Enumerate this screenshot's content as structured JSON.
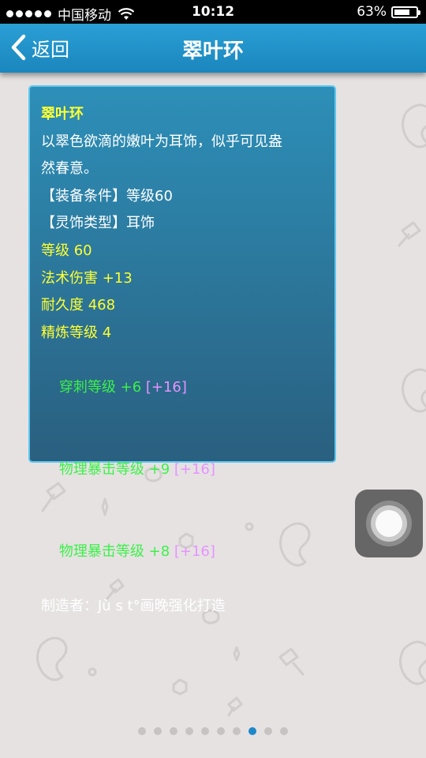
{
  "status_bar": {
    "carrier": "中国移动",
    "time": "10:12",
    "battery_percent": "63%",
    "battery_level": 0.63
  },
  "nav": {
    "back_label": "返回",
    "title": "翠叶环"
  },
  "item": {
    "name": "翠叶环",
    "description_1": "以翠色欲滴的嫩叶为耳饰，似乎可见盎",
    "description_2": "然春意。",
    "requirement": "【装备条件】等级60",
    "type": "【灵饰类型】耳饰",
    "stats": [
      {
        "text": "等级 60"
      },
      {
        "text": "法术伤害 +13"
      },
      {
        "text": "耐久度 468"
      },
      {
        "text": "精炼等级 4"
      }
    ],
    "bonuses": [
      {
        "text": "穿刺等级 +6 ",
        "extra": "[+16]"
      },
      {
        "text": "物理暴击等级 +9 ",
        "extra": "[+16]"
      },
      {
        "text": "物理暴击等级 +8 ",
        "extra": "[+16]"
      }
    ],
    "maker": "制造者：Jù s t°画晚强化打造"
  },
  "pager": {
    "total": 10,
    "active_index": 7
  },
  "colors": {
    "nav_blue": "#1a86bd",
    "card_top": "#2d8fb8",
    "card_border": "#5ec7ee",
    "title_yellow": "#ffff33",
    "bonus_green": "#3df04a",
    "extra_pink": "#e693ff",
    "pager_active": "#1e88c9"
  }
}
